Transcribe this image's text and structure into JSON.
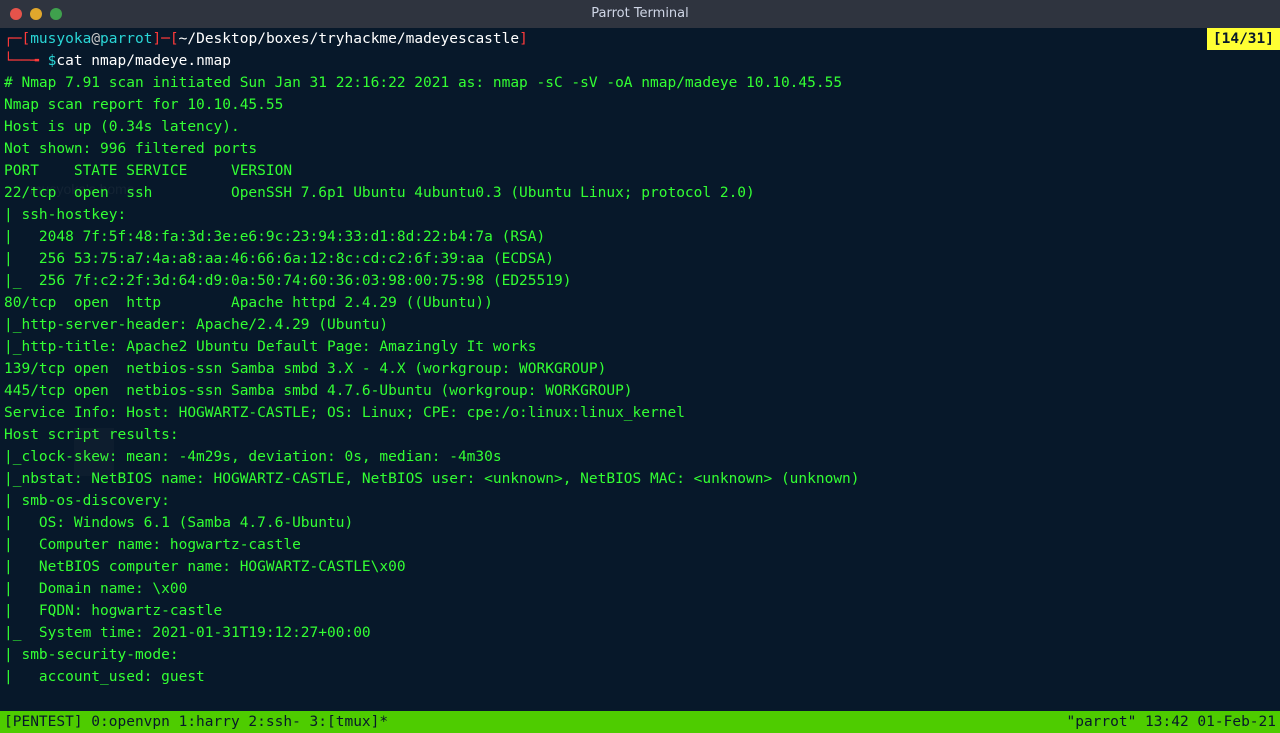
{
  "window": {
    "title": "Parrot Terminal"
  },
  "counter": "[14/31]",
  "prompt": {
    "corner1": "┌─[",
    "user": "musyoka",
    "at": "@",
    "host": "parrot",
    "sep1": "]─[",
    "path": "~/Desktop/boxes/tryhackme/madeyescastle",
    "close": "]",
    "corner2": "└──╼ ",
    "dollar": "$",
    "command": "cat nmap/madeye.nmap"
  },
  "output": {
    "l1": "# Nmap 7.91 scan initiated Sun Jan 31 22:16:22 2021 as: nmap -sC -sV -oA nmap/madeye 10.10.45.55",
    "l2": "Nmap scan report for 10.10.45.55",
    "l3": "Host is up (0.34s latency).",
    "l4": "Not shown: 996 filtered ports",
    "l5": "PORT    STATE SERVICE     VERSION",
    "l6": "22/tcp  open  ssh         OpenSSH 7.6p1 Ubuntu 4ubuntu0.3 (Ubuntu Linux; protocol 2.0)",
    "l7": "| ssh-hostkey:",
    "l8": "|   2048 7f:5f:48:fa:3d:3e:e6:9c:23:94:33:d1:8d:22:b4:7a (RSA)",
    "l9": "|   256 53:75:a7:4a:a8:aa:46:66:6a:12:8c:cd:c2:6f:39:aa (ECDSA)",
    "l10": "|_  256 7f:c2:2f:3d:64:d9:0a:50:74:60:36:03:98:00:75:98 (ED25519)",
    "l11": "80/tcp  open  http        Apache httpd 2.4.29 ((Ubuntu))",
    "l12": "|_http-server-header: Apache/2.4.29 (Ubuntu)",
    "l13": "|_http-title: Apache2 Ubuntu Default Page: Amazingly It works",
    "l14": "139/tcp open  netbios-ssn Samba smbd 3.X - 4.X (workgroup: WORKGROUP)",
    "l15": "445/tcp open  netbios-ssn Samba smbd 4.7.6-Ubuntu (workgroup: WORKGROUP)",
    "l16": "Service Info: Host: HOGWARTZ-CASTLE; OS: Linux; CPE: cpe:/o:linux:linux_kernel",
    "l17": "",
    "l18": "Host script results:",
    "l19": "|_clock-skew: mean: -4m29s, deviation: 0s, median: -4m30s",
    "l20": "|_nbstat: NetBIOS name: HOGWARTZ-CASTLE, NetBIOS user: <unknown>, NetBIOS MAC: <unknown> (unknown)",
    "l21": "| smb-os-discovery:",
    "l22": "|   OS: Windows 6.1 (Samba 4.7.6-Ubuntu)",
    "l23": "|   Computer name: hogwartz-castle",
    "l24": "|   NetBIOS computer name: HOGWARTZ-CASTLE\\x00",
    "l25": "|   Domain name: \\x00",
    "l26": "|   FQDN: hogwartz-castle",
    "l27": "|_  System time: 2021-01-31T19:12:27+00:00",
    "l28": "| smb-security-mode:",
    "l29": "|   account_used: guest"
  },
  "status": {
    "left": "[PENTEST] 0:openvpn  1:harry  2:ssh- 3:[tmux]*",
    "right": "\"parrot\" 13:42 01-Feb-21"
  },
  "watermark": "musyoka's home"
}
